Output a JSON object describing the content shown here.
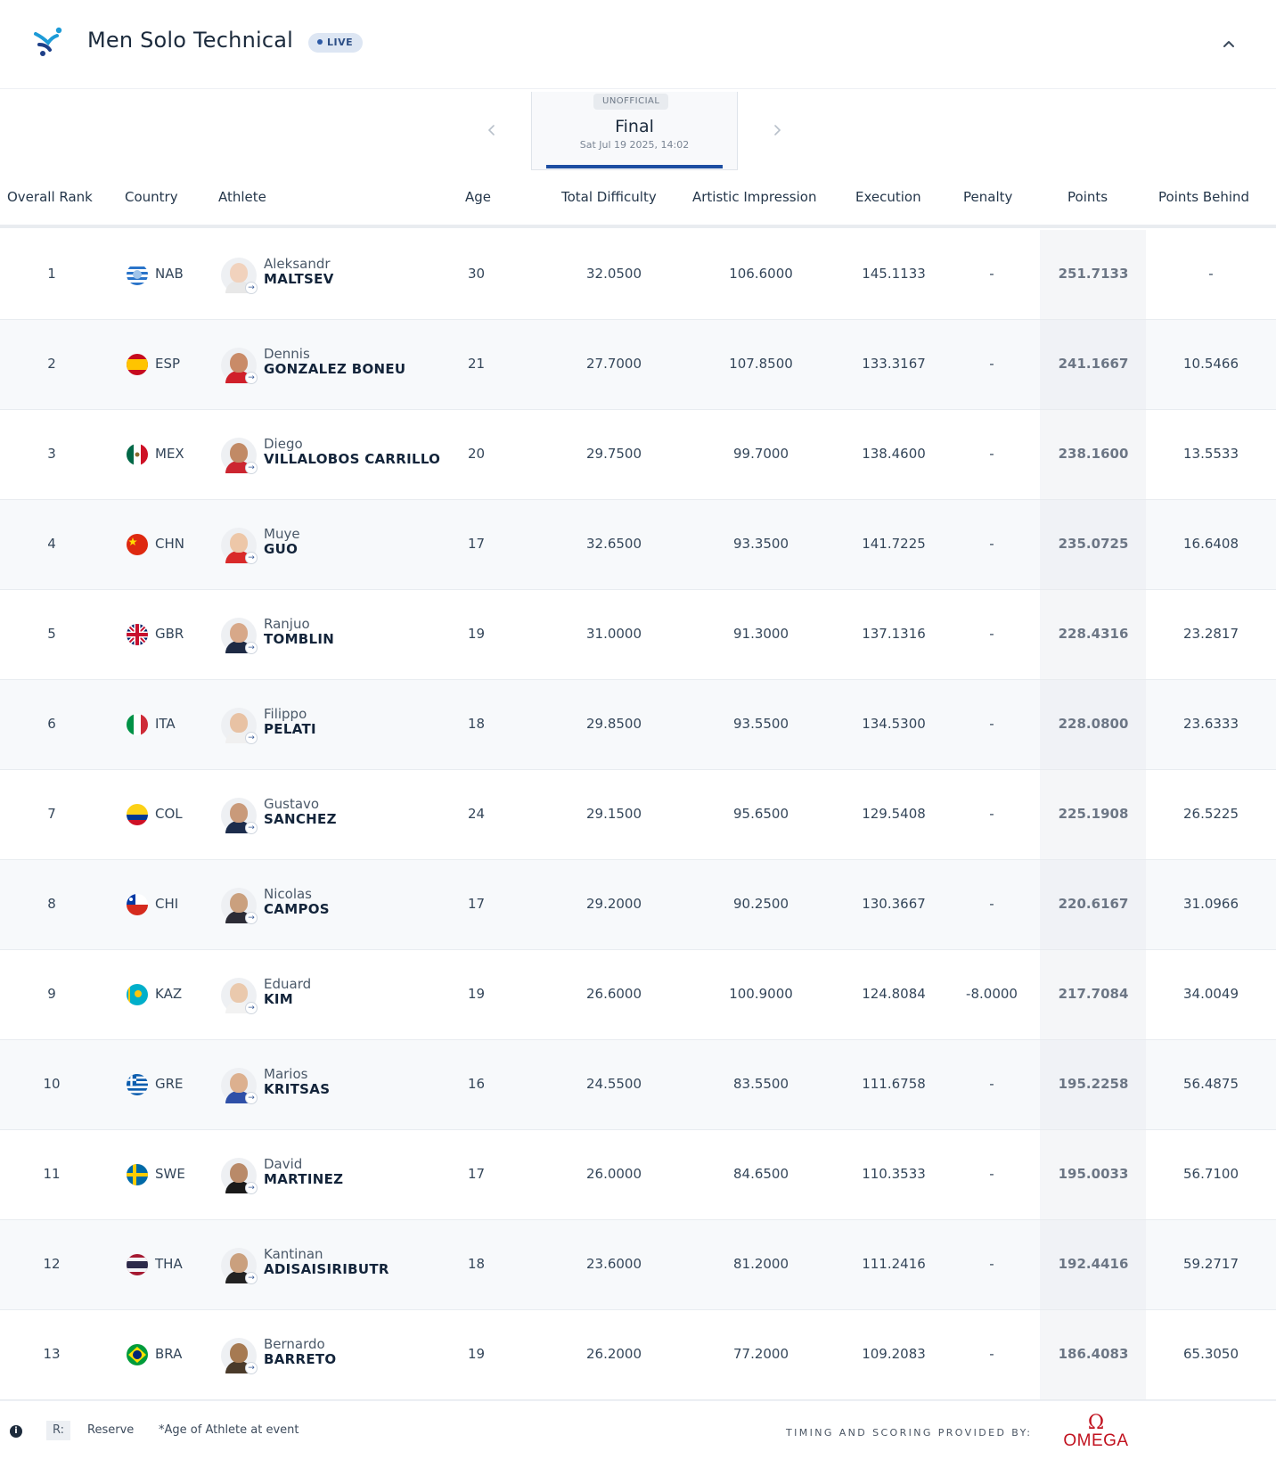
{
  "header": {
    "title": "Men Solo Technical",
    "live_label": "LIVE"
  },
  "phase": {
    "status": "UNOFFICIAL",
    "name": "Final",
    "date": "Sat Jul 19 2025, 14:02"
  },
  "columns": [
    "Overall Rank",
    "Country",
    "Athlete",
    "Age",
    "Total Difficulty",
    "Artistic Impression",
    "Execution",
    "Penalty",
    "Points",
    "Points Behind"
  ],
  "rows": [
    {
      "rank": "1",
      "country": "NAB",
      "first": "Aleksandr",
      "last": "MALTSEV",
      "age": "30",
      "difficulty": "32.0500",
      "artistic": "106.6000",
      "execution": "145.1133",
      "penalty": "-",
      "points": "251.7133",
      "behind": "-"
    },
    {
      "rank": "2",
      "country": "ESP",
      "first": "Dennis",
      "last": "GONZALEZ BONEU",
      "age": "21",
      "difficulty": "27.7000",
      "artistic": "107.8500",
      "execution": "133.3167",
      "penalty": "-",
      "points": "241.1667",
      "behind": "10.5466"
    },
    {
      "rank": "3",
      "country": "MEX",
      "first": "Diego",
      "last": "VILLALOBOS CARRILLO",
      "age": "20",
      "difficulty": "29.7500",
      "artistic": "99.7000",
      "execution": "138.4600",
      "penalty": "-",
      "points": "238.1600",
      "behind": "13.5533"
    },
    {
      "rank": "4",
      "country": "CHN",
      "first": "Muye",
      "last": "GUO",
      "age": "17",
      "difficulty": "32.6500",
      "artistic": "93.3500",
      "execution": "141.7225",
      "penalty": "-",
      "points": "235.0725",
      "behind": "16.6408"
    },
    {
      "rank": "5",
      "country": "GBR",
      "first": "Ranjuo",
      "last": "TOMBLIN",
      "age": "19",
      "difficulty": "31.0000",
      "artistic": "91.3000",
      "execution": "137.1316",
      "penalty": "-",
      "points": "228.4316",
      "behind": "23.2817"
    },
    {
      "rank": "6",
      "country": "ITA",
      "first": "Filippo",
      "last": "PELATI",
      "age": "18",
      "difficulty": "29.8500",
      "artistic": "93.5500",
      "execution": "134.5300",
      "penalty": "-",
      "points": "228.0800",
      "behind": "23.6333"
    },
    {
      "rank": "7",
      "country": "COL",
      "first": "Gustavo",
      "last": "SANCHEZ",
      "age": "24",
      "difficulty": "29.1500",
      "artistic": "95.6500",
      "execution": "129.5408",
      "penalty": "-",
      "points": "225.1908",
      "behind": "26.5225"
    },
    {
      "rank": "8",
      "country": "CHI",
      "first": "Nicolas",
      "last": "CAMPOS",
      "age": "17",
      "difficulty": "29.2000",
      "artistic": "90.2500",
      "execution": "130.3667",
      "penalty": "-",
      "points": "220.6167",
      "behind": "31.0966"
    },
    {
      "rank": "9",
      "country": "KAZ",
      "first": "Eduard",
      "last": "KIM",
      "age": "19",
      "difficulty": "26.6000",
      "artistic": "100.9000",
      "execution": "124.8084",
      "penalty": "-8.0000",
      "points": "217.7084",
      "behind": "34.0049"
    },
    {
      "rank": "10",
      "country": "GRE",
      "first": "Marios",
      "last": "KRITSAS",
      "age": "16",
      "difficulty": "24.5500",
      "artistic": "83.5500",
      "execution": "111.6758",
      "penalty": "-",
      "points": "195.2258",
      "behind": "56.4875"
    },
    {
      "rank": "11",
      "country": "SWE",
      "first": "David",
      "last": "MARTINEZ",
      "age": "17",
      "difficulty": "26.0000",
      "artistic": "84.6500",
      "execution": "110.3533",
      "penalty": "-",
      "points": "195.0033",
      "behind": "56.7100"
    },
    {
      "rank": "12",
      "country": "THA",
      "first": "Kantinan",
      "last": "ADISAISIRIBUTR",
      "age": "18",
      "difficulty": "23.6000",
      "artistic": "81.2000",
      "execution": "111.2416",
      "penalty": "-",
      "points": "192.4416",
      "behind": "59.2717"
    },
    {
      "rank": "13",
      "country": "BRA",
      "first": "Bernardo",
      "last": "BARRETO",
      "age": "19",
      "difficulty": "26.2000",
      "artistic": "77.2000",
      "execution": "109.2083",
      "penalty": "-",
      "points": "186.4083",
      "behind": "65.3050"
    }
  ],
  "footer": {
    "reserve_key": "R:",
    "reserve_label": "Reserve",
    "age_note": "*Age of Athlete at event",
    "timing_text": "TIMING AND SCORING PROVIDED BY:",
    "sponsor": "OMEGA"
  },
  "colors": {
    "accent": "#1d4ea2",
    "text": "#1b2a3c",
    "omega_red": "#c1121f"
  }
}
